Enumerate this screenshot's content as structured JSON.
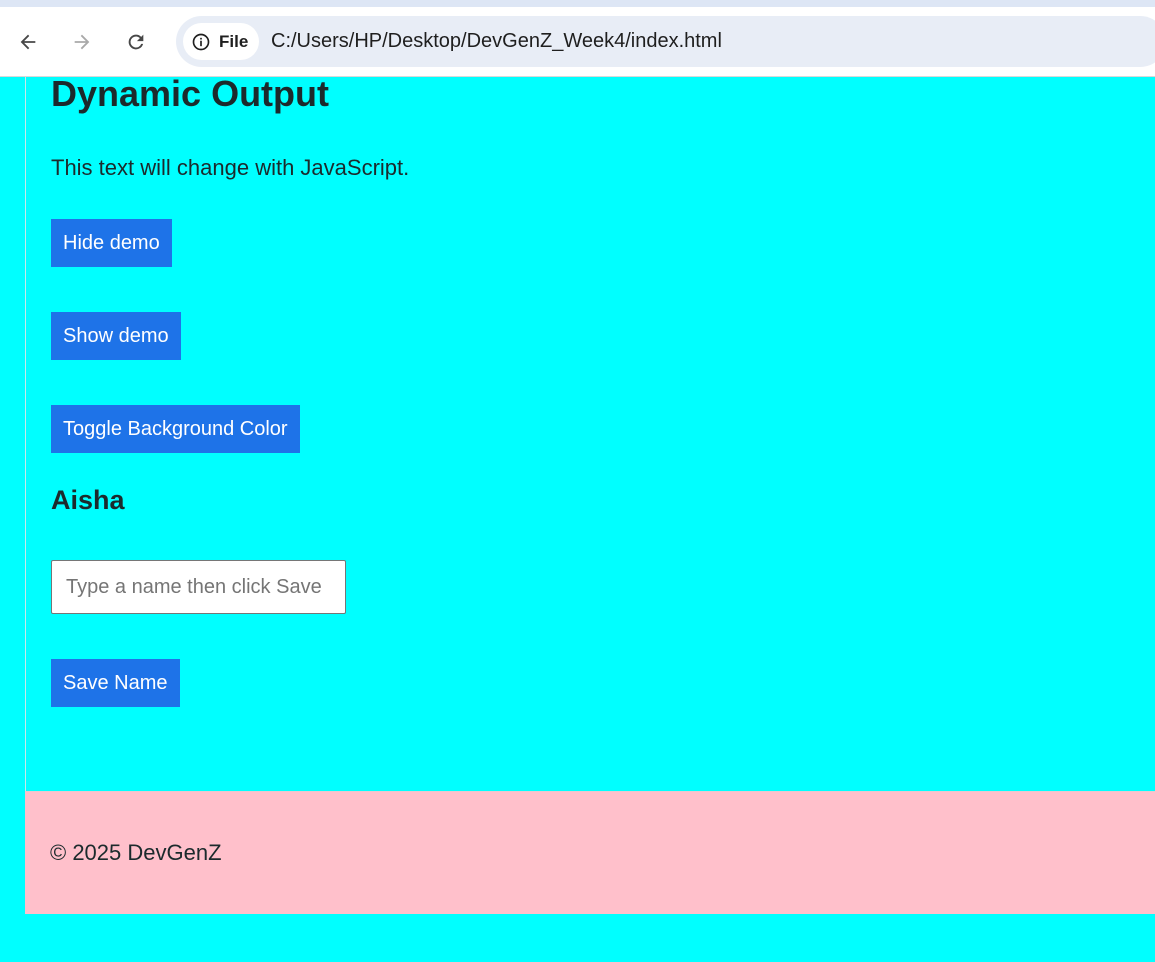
{
  "browser": {
    "address_bar": {
      "site_info_label": "File",
      "url": "C:/Users/HP/Desktop/DevGenZ_Week4/index.html"
    },
    "icons": {
      "back": "back-arrow-icon",
      "forward": "forward-arrow-icon",
      "reload": "reload-icon",
      "info": "info-icon"
    }
  },
  "main": {
    "heading": "Dynamic Output",
    "demo_text": "This text will change with JavaScript.",
    "hide_button": "Hide demo",
    "show_button": "Show demo",
    "toggle_button": "Toggle Background Color",
    "name_heading": "Aisha",
    "name_input": {
      "placeholder": "Type a name then click Save",
      "value": ""
    },
    "save_button": "Save Name"
  },
  "footer": {
    "text": "© 2025 DevGenZ"
  },
  "colors": {
    "page_background": "#00ffff",
    "button_background": "#1e73e8",
    "button_text": "#ffffff",
    "footer_background": "#ffc0cb",
    "text": "#1c2a2c"
  }
}
